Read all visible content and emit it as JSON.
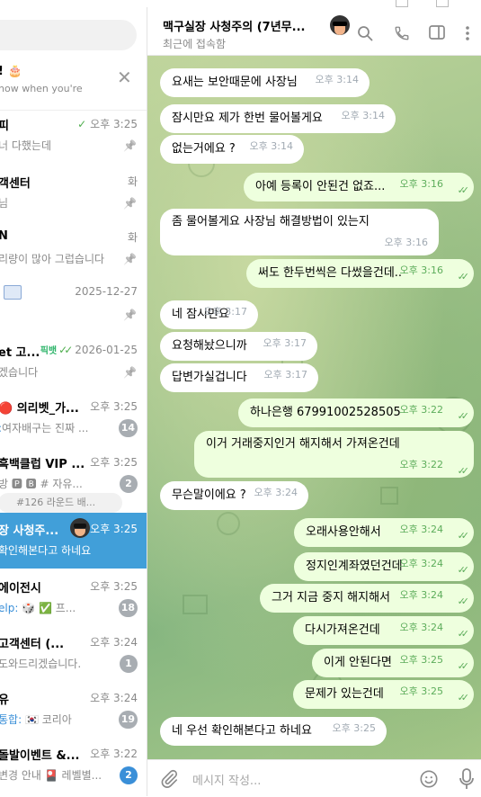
{
  "left": {
    "promo": {
      "title": "! 🎂",
      "subtitle": "now when you're"
    },
    "chats": [
      {
        "name": "피",
        "time": "오후 3:25",
        "preview": "너 다했는데",
        "pinned": true,
        "read": true
      },
      {
        "name": "객센터",
        "time": "화",
        "preview": "님",
        "pinned": true
      },
      {
        "name": "N",
        "time": "화",
        "preview": "리량이 많아 그럽습니다",
        "pinned": true
      },
      {
        "name": "",
        "time": "2025-12-27",
        "preview": "",
        "pinned": true
      },
      {
        "name": "et 고...",
        "time": "2026-01-25",
        "tag": "픽뱃",
        "preview": "겠습니다",
        "pinned": true
      },
      {
        "name": "🔴 의리벳_가...",
        "time": "오후 3:25",
        "preview_prefix": ":",
        "preview": "여자배구는 진짜 ...",
        "badge": "14"
      },
      {
        "name": "흑백클럽 VIP ...",
        "time": "오후 3:25",
        "preview": "방 🅿 🅱   # 자유...",
        "badge": "2",
        "topic": "#126 라운드 배..."
      },
      {
        "name": "장 사청주...",
        "time": "오후 3:25",
        "preview": "확인해본다고 하네요",
        "active": true
      },
      {
        "name": "에이전시",
        "time": "오후 3:25",
        "preview_prefix": "elp:",
        "preview": " 🎲 ✅ 프...",
        "badge": "18"
      },
      {
        "name": "고객센터 (...",
        "time": "오후 3:24",
        "preview": "도와드리겠습니다.",
        "badge": "1"
      },
      {
        "name": "유",
        "time": "오후 3:24",
        "preview_prefix": "통합:",
        "preview": " 🇰🇷 코리아",
        "badge": "19"
      },
      {
        "name": "돌발이벤트 &...",
        "time": "오후 3:22",
        "preview": "변경 안내 🎴 레벨별...",
        "badge": "2",
        "badge_blue": true
      }
    ]
  },
  "header": {
    "title": "맥구실장 사청주의 (7년무...",
    "status": "최근에 접속함"
  },
  "messages": [
    {
      "dir": "in",
      "text": "요새는 보안때문에 사장님",
      "time": "오후 3:14"
    },
    {
      "dir": "in",
      "text": "잠시만요 제가 한번 물어볼게요",
      "time": "오후 3:14"
    },
    {
      "dir": "in",
      "text": "없는거에요 ?",
      "time": "오후 3:14"
    },
    {
      "dir": "out",
      "text": "아예 등록이 안된건 없죠...",
      "time": "오후 3:16"
    },
    {
      "dir": "in",
      "text": "좀 물어볼게요 사장님 해결방법이 있는지",
      "time": "오후 3:16"
    },
    {
      "dir": "out",
      "text": "써도 한두번씩은 다썼을건데..",
      "time": "오후 3:16"
    },
    {
      "dir": "in",
      "text": "네 잠시만요",
      "time": "오후 3:17"
    },
    {
      "dir": "in",
      "text": "요청해놨으니까",
      "time": "오후 3:17"
    },
    {
      "dir": "in",
      "text": "답변가실겁니다",
      "time": "오후 3:17"
    },
    {
      "dir": "out",
      "text": "하나은행 67991002528505",
      "time": "오후 3:22"
    },
    {
      "dir": "out",
      "text": "이거 거래중지인거 해지해서 가져온건데",
      "time": "오후 3:22"
    },
    {
      "dir": "in",
      "text": "무슨말이에요 ?",
      "time": "오후 3:24"
    },
    {
      "dir": "out",
      "text": "오래사용안해서",
      "time": "오후 3:24"
    },
    {
      "dir": "out",
      "text": "정지인계좌였던건데",
      "time": "오후 3:24"
    },
    {
      "dir": "out",
      "text": "그거 지금 중지 해지해서",
      "time": "오후 3:24"
    },
    {
      "dir": "out",
      "text": "다시가져온건데",
      "time": "오후 3:24"
    },
    {
      "dir": "out",
      "text": "이게 안된다면",
      "time": "오후 3:25"
    },
    {
      "dir": "out",
      "text": "문제가 있는건데",
      "time": "오후 3:25"
    },
    {
      "dir": "in",
      "text": "네 우선 확인해본다고 하네요",
      "time": "오후 3:25"
    }
  ],
  "input": {
    "placeholder": "메시지 작성..."
  },
  "icons": {
    "search": "search-icon",
    "call": "phone-icon",
    "sidebar": "sidebar-toggle-icon",
    "more": "more-vertical-icon",
    "attach": "paperclip-icon",
    "emoji": "emoji-icon",
    "mic": "microphone-icon",
    "pin": "pin-icon",
    "read": "double-check-icon",
    "close": "close-icon"
  },
  "colors": {
    "accent": "#419fd9",
    "outgoing_bubble": "#eeffde",
    "incoming_bubble": "#ffffff",
    "check": "#5dad5b",
    "badge_muted": "#a8adb2"
  }
}
